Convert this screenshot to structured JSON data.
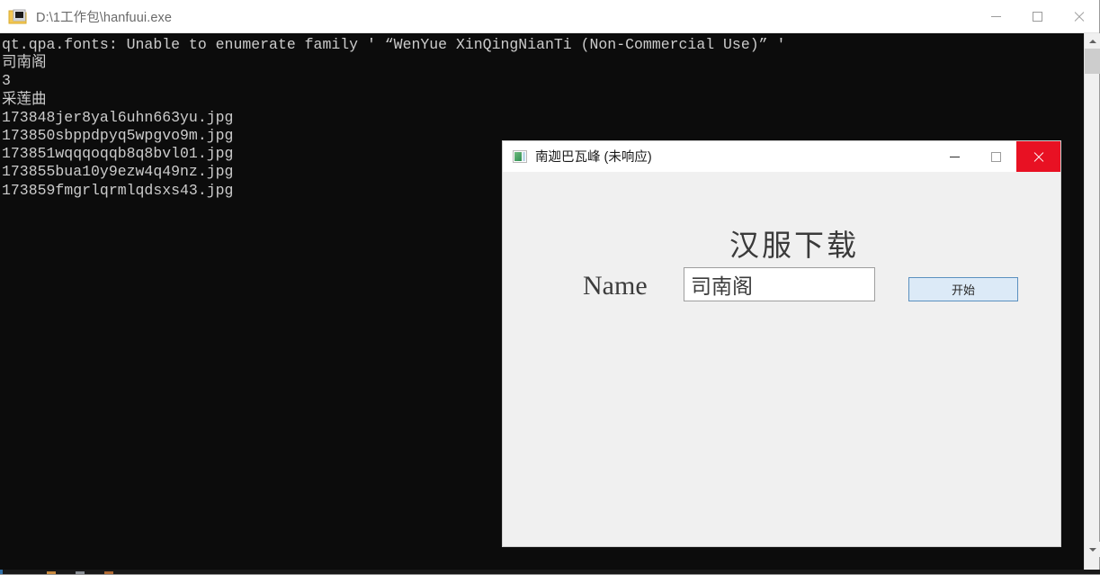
{
  "console_window": {
    "title": "D:\\1工作包\\hanfuui.exe",
    "icon": "folder-exe-icon",
    "controls": {
      "minimize": "minimize-icon",
      "maximize": "maximize-icon",
      "close": "close-icon"
    },
    "output_lines": [
      "qt.qpa.fonts: Unable to enumerate family ' “WenYue XinQingNianTi (Non-Commercial Use)” '",
      "司南阁",
      "3",
      "采莲曲",
      "173848jer8yal6uhn663yu.jpg",
      "173850sbppdpyq5wpgvo9m.jpg",
      "173851wqqqoqqb8q8bvl01.jpg",
      "173855bua10y9ezw4q49nz.jpg",
      "173859fmgrlqrmlqdsxs43.jpg"
    ],
    "text_color": "#cccccc",
    "background_color": "#0c0c0c",
    "scrollbar": {
      "up_arrow": "chevron-up-icon",
      "down_arrow": "chevron-down-icon",
      "thumb_color": "#cdcdcd",
      "track_color": "#f0f0f0"
    }
  },
  "dialog": {
    "title": "南迦巴瓦峰 (未响应)",
    "icon": "app-window-icon",
    "controls": {
      "minimize": "minimize-icon",
      "maximize": "maximize-icon",
      "close": "close-icon"
    },
    "close_button_color": "#e81123",
    "heading": "汉服下载",
    "name_label": "Name",
    "name_value": "司南阁",
    "name_placeholder": "",
    "start_button": "开始",
    "button_fill": "#dceaf7",
    "button_border": "#5b90bf",
    "background_color": "#f0f0f0"
  }
}
